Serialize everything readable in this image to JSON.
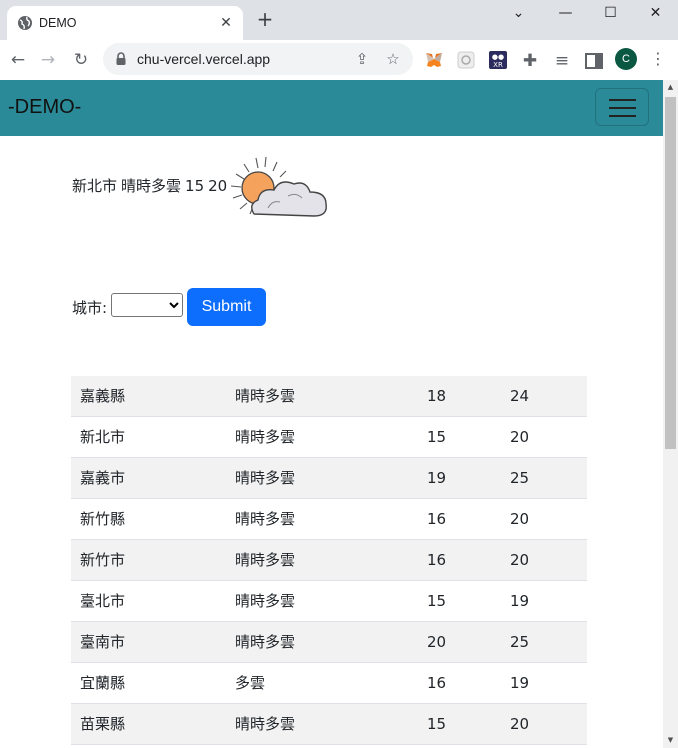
{
  "browser": {
    "tab_title": "DEMO",
    "url": "chu-vercel.vercel.app",
    "profile_initial": "C"
  },
  "page": {
    "brand": "-DEMO-",
    "current_weather": {
      "city": "新北市",
      "description": "晴時多雲",
      "min_temp": "15",
      "max_temp": "20",
      "icon": "sun-behind-cloud-icon"
    },
    "form": {
      "city_label": "城市:",
      "selected_city": "",
      "submit_label": "Submit"
    },
    "table": {
      "rows": [
        {
          "city": "嘉義縣",
          "weather": "晴時多雲",
          "min": "18",
          "max": "24"
        },
        {
          "city": "新北市",
          "weather": "晴時多雲",
          "min": "15",
          "max": "20"
        },
        {
          "city": "嘉義市",
          "weather": "晴時多雲",
          "min": "19",
          "max": "25"
        },
        {
          "city": "新竹縣",
          "weather": "晴時多雲",
          "min": "16",
          "max": "20"
        },
        {
          "city": "新竹市",
          "weather": "晴時多雲",
          "min": "16",
          "max": "20"
        },
        {
          "city": "臺北市",
          "weather": "晴時多雲",
          "min": "15",
          "max": "19"
        },
        {
          "city": "臺南市",
          "weather": "晴時多雲",
          "min": "20",
          "max": "25"
        },
        {
          "city": "宜蘭縣",
          "weather": "多雲",
          "min": "16",
          "max": "19"
        },
        {
          "city": "苗栗縣",
          "weather": "晴時多雲",
          "min": "15",
          "max": "20"
        }
      ]
    }
  },
  "colors": {
    "navbar": "#2a8a98",
    "submit": "#0d6efd",
    "stripe": "#f2f2f2"
  }
}
